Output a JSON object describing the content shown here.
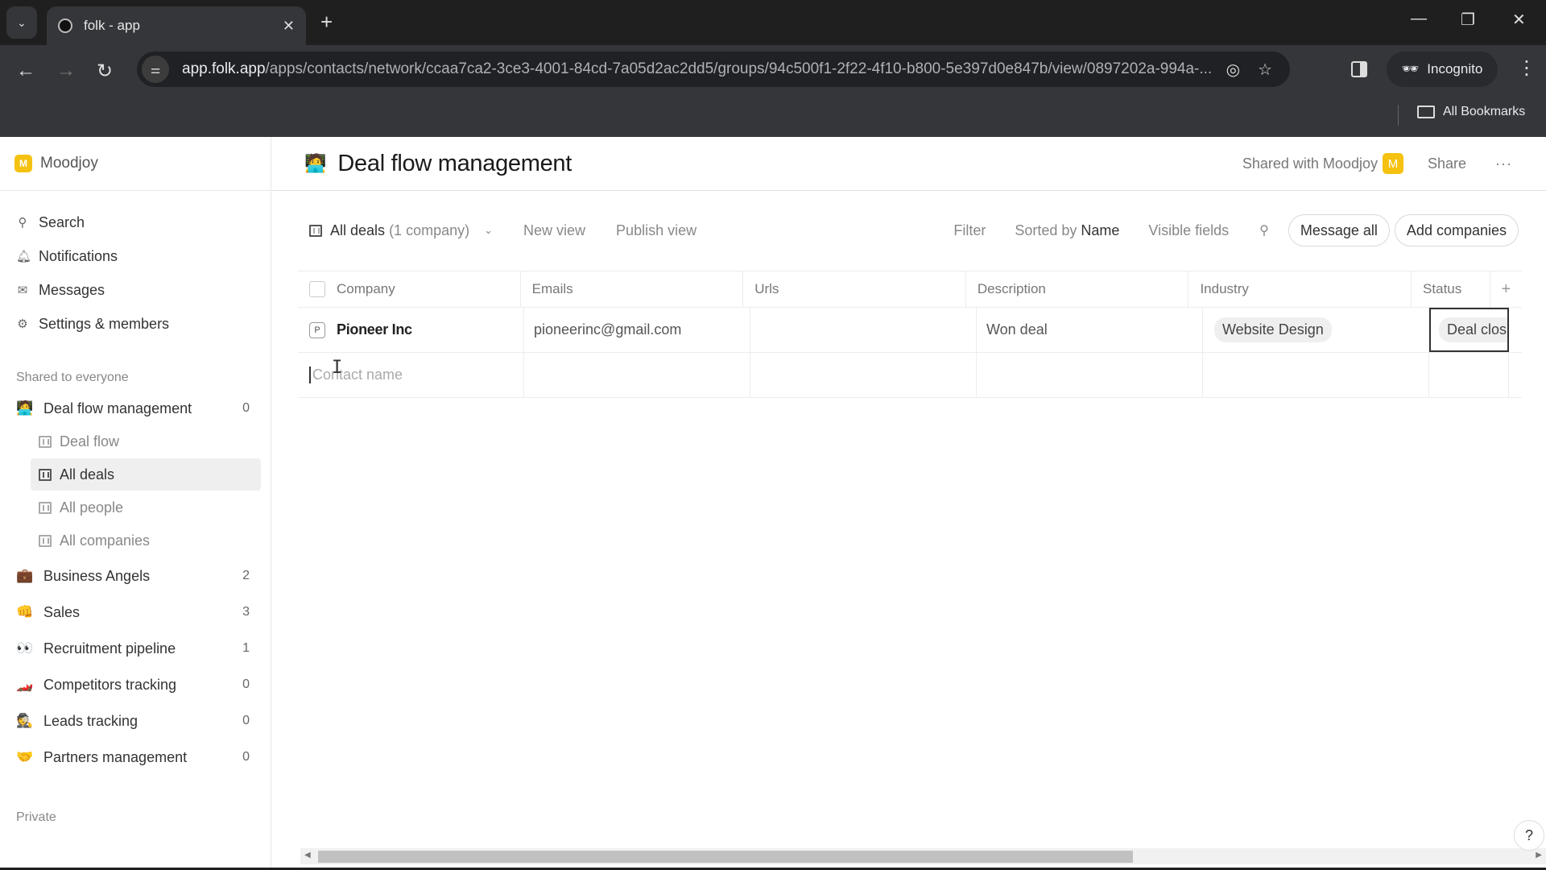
{
  "browser": {
    "tab_title": "folk - app",
    "url_host": "app.folk.app",
    "url_path": "/apps/contacts/network/ccaa7ca2-3ce3-4001-84cd-7a05d2ac2dd5/groups/94c500f1-2f22-4f10-b800-5e397d0e847b/view/0897202a-994a-...",
    "incognito_label": "Incognito",
    "bookmarks_label": "All Bookmarks"
  },
  "workspace": {
    "badge": "M",
    "name": "Moodjoy"
  },
  "sidebar": {
    "nav": [
      {
        "icon": "search-icon",
        "label": "Search"
      },
      {
        "icon": "bell-icon",
        "label": "Notifications"
      },
      {
        "icon": "mail-icon",
        "label": "Messages"
      },
      {
        "icon": "gear-icon",
        "label": "Settings & members"
      }
    ],
    "shared_label": "Shared to everyone",
    "groups": [
      {
        "emoji": "🧑‍💻",
        "label": "Deal flow management",
        "count": "0",
        "views": [
          {
            "label": "Deal flow",
            "active": false
          },
          {
            "label": "All deals",
            "active": true
          },
          {
            "label": "All people",
            "active": false
          },
          {
            "label": "All companies",
            "active": false
          }
        ]
      },
      {
        "emoji": "💼",
        "label": "Business Angels",
        "count": "2"
      },
      {
        "emoji": "👊",
        "label": "Sales",
        "count": "3"
      },
      {
        "emoji": "👀",
        "label": "Recruitment pipeline",
        "count": "1"
      },
      {
        "emoji": "🏎️",
        "label": "Competitors tracking",
        "count": "0"
      },
      {
        "emoji": "🕵️",
        "label": "Leads tracking",
        "count": "0"
      },
      {
        "emoji": "🤝",
        "label": "Partners management",
        "count": "0"
      }
    ],
    "private_label": "Private"
  },
  "header": {
    "emoji": "🧑‍💻",
    "title": "Deal flow management",
    "shared_with": "Shared with Moodjoy",
    "shared_badge": "M",
    "share_label": "Share",
    "more_label": "···"
  },
  "toolbar": {
    "view_name": "All deals",
    "view_count": "(1 company)",
    "new_view": "New view",
    "publish_view": "Publish view",
    "filter": "Filter",
    "sorted_by_prefix": "Sorted by",
    "sorted_by_field": "Name",
    "visible_fields": "Visible fields",
    "message_all": "Message all",
    "add_companies": "Add companies"
  },
  "table": {
    "columns": [
      "Company",
      "Emails",
      "Urls",
      "Description",
      "Industry",
      "Status"
    ],
    "rows": [
      {
        "badge": "P",
        "company": "Pioneer Inc",
        "email": "pioneerinc@gmail.com",
        "urls": "",
        "description": "Won deal",
        "industry": "Website Design",
        "status": "Deal clos"
      }
    ],
    "new_row_placeholder": "Contact name"
  },
  "help_label": "?"
}
